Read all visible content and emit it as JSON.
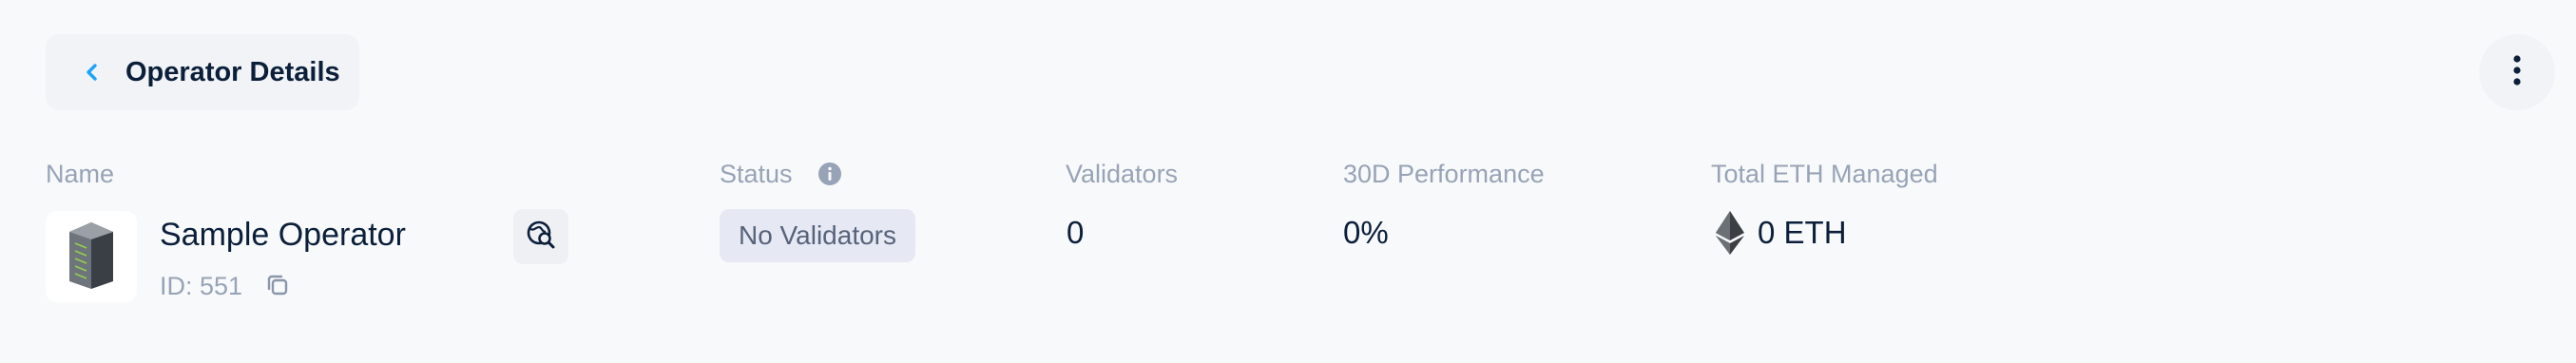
{
  "header": {
    "back_label": "Operator Details"
  },
  "columns": {
    "name": "Name",
    "status": "Status",
    "validators": "Validators",
    "performance": "30D Performance",
    "eth_managed": "Total ETH Managed"
  },
  "operator": {
    "name": "Sample Operator",
    "id_label": "ID: 551",
    "status": "No Validators",
    "validators": "0",
    "performance": "0%",
    "eth_managed": "0 ETH"
  },
  "icons": {
    "back": "chevron-left-icon",
    "more": "kebab-menu-icon",
    "info": "info-icon",
    "avatar": "server-rack-icon",
    "explorer": "explorer-search-icon",
    "copy": "copy-icon",
    "eth": "ethereum-icon"
  },
  "colors": {
    "background": "#f8f9fb",
    "title_text": "#0b1f3a",
    "muted_text": "#97a3b6",
    "accent": "#1ba5f8",
    "status_badge_bg": "#e6e8f4",
    "status_badge_text": "#56637a"
  }
}
